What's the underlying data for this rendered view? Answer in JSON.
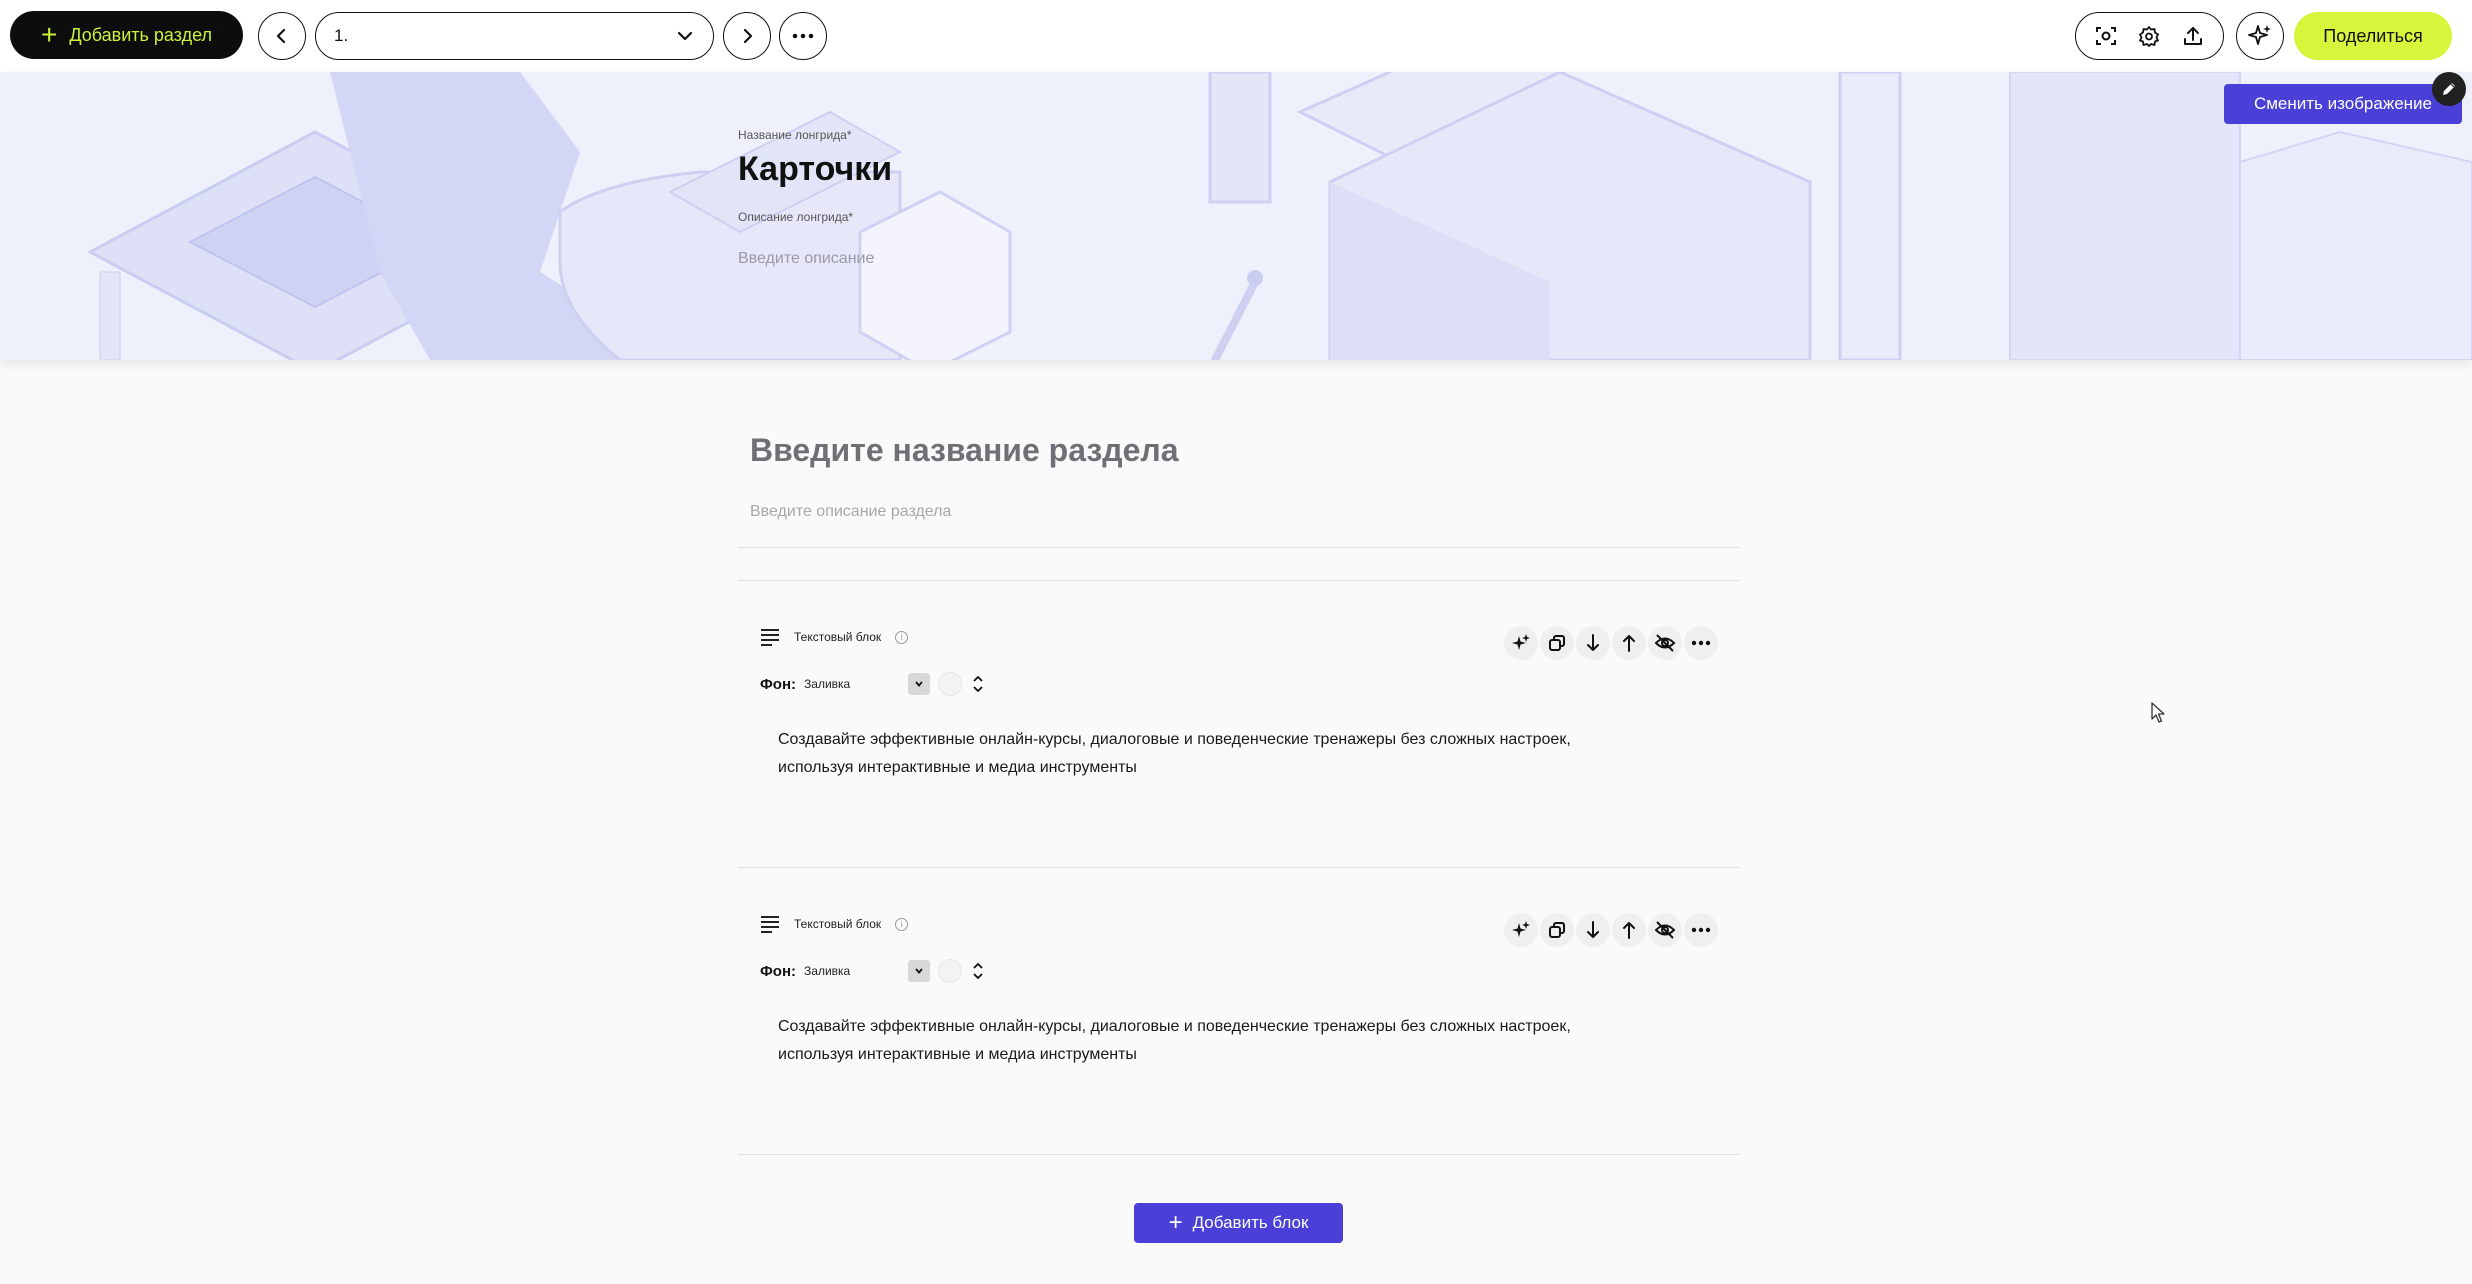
{
  "toolbar": {
    "add_section_label": "Добавить раздел",
    "section_select_value": "1.",
    "share_label": "Поделиться"
  },
  "hero": {
    "name_label": "Название лонгрида*",
    "title": "Карточки",
    "description_label": "Описание лонгрида*",
    "description_placeholder": "Введите описание",
    "change_image_label": "Сменить изображение"
  },
  "section": {
    "title_placeholder": "Введите название раздела",
    "description_placeholder": "Введите описание раздела"
  },
  "blocks": [
    {
      "type_label": "Текстовый блок",
      "bg_label": "Фон:",
      "bg_value": "Заливка",
      "text_line1": "Создавайте эффективные онлайн-курсы, диалоговые и поведенческие тренажеры без сложных настроек,",
      "text_line2": "используя интерактивные и медиа инструменты"
    },
    {
      "type_label": "Текстовый блок",
      "bg_label": "Фон:",
      "bg_value": "Заливка",
      "text_line1": "Создавайте эффективные онлайн-курсы, диалоговые и поведенческие тренажеры без сложных настроек,",
      "text_line2": "используя интерактивные и медиа инструменты"
    }
  ],
  "add_block_label": "Добавить блок",
  "colors": {
    "accent": "#4a3fd6",
    "share": "#d7f53a",
    "add_section_text": "#c9f23a"
  }
}
